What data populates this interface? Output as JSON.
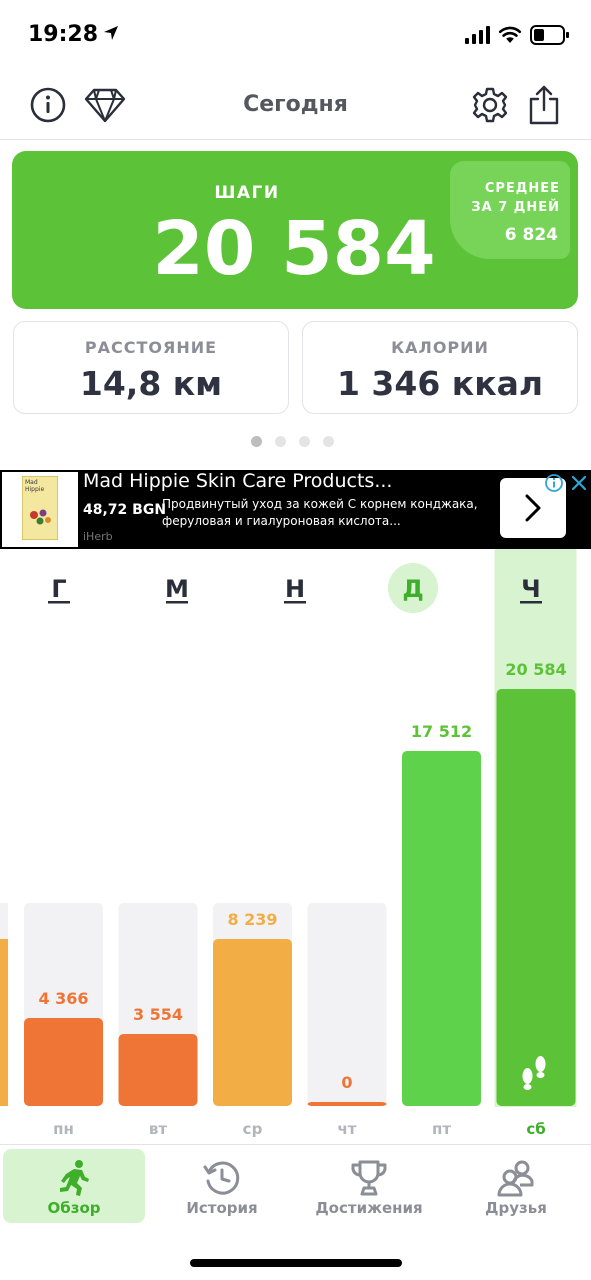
{
  "status_bar": {
    "time": "19:28"
  },
  "header": {
    "title": "Сегодня"
  },
  "steps_card": {
    "label": "ШАГИ",
    "value": "20 584",
    "average_label_line1": "СРЕДНЕЕ",
    "average_label_line2": "ЗА 7 ДНЕЙ",
    "average_value": "6 824"
  },
  "metrics": {
    "distance": {
      "label": "РАССТОЯНИЕ",
      "value": "14,8 км"
    },
    "calories": {
      "label": "КАЛОРИИ",
      "value": "1 346 ккал"
    }
  },
  "pager": {
    "count": 4,
    "active_index": 0
  },
  "ad": {
    "title": "Mad Hippie Skin Care Products...",
    "price": "48,72 BGN",
    "description": "Продвинутый уход за кожей С корнем конджака, феруловая и гиалуроновая кислота...",
    "source": "iHerb",
    "product_text": "Mad Hippie"
  },
  "chart_data": {
    "type": "bar",
    "categories": [
      "пн",
      "вт",
      "ср",
      "чт",
      "пт",
      "сб"
    ],
    "values": [
      4366,
      3554,
      8239,
      0,
      17512,
      20584
    ],
    "value_labels": [
      "4 366",
      "3 554",
      "8 239",
      "0",
      "17 512",
      "20 584"
    ],
    "bar_colors": [
      "#ee7536",
      "#ee7536",
      "#f2ae45",
      "#ee7536",
      "#5ed24a",
      "#5cc237"
    ],
    "label_colors": [
      "#ee7536",
      "#ee7536",
      "#f2ae45",
      "#ee7536",
      "#5cc237",
      "#5cc237"
    ],
    "highlighted_category": "сб",
    "period_tabs": [
      {
        "label": "Г",
        "active": false
      },
      {
        "label": "М",
        "active": false
      },
      {
        "label": "Н",
        "active": false
      },
      {
        "label": "Д",
        "active": true
      },
      {
        "label": "Ч",
        "active": false
      }
    ],
    "ylim": [
      0,
      20584
    ]
  },
  "tabs": [
    {
      "label": "Обзор",
      "icon": "runner-icon",
      "active": true
    },
    {
      "label": "История",
      "icon": "history-icon",
      "active": false
    },
    {
      "label": "Достижения",
      "icon": "trophy-icon",
      "active": false
    },
    {
      "label": "Друзья",
      "icon": "friends-icon",
      "active": false
    }
  ]
}
